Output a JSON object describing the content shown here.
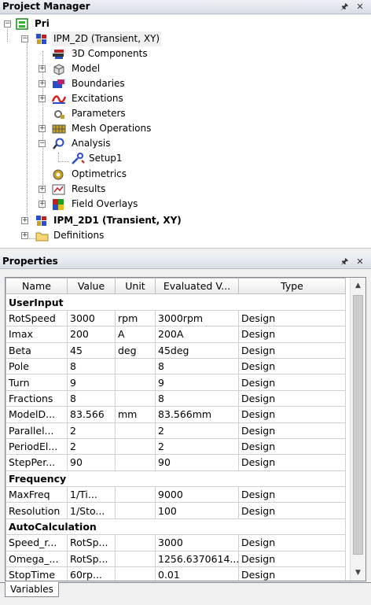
{
  "project_manager": {
    "title": "Project Manager",
    "pin": "p",
    "close": "✕",
    "tree": {
      "root": "Pri",
      "design1": "IPM_2D (Transient, XY)",
      "items": [
        "3D Components",
        "Model",
        "Boundaries",
        "Excitations",
        "Parameters",
        "Mesh Operations",
        "Analysis",
        "Optimetrics",
        "Results",
        "Field Overlays"
      ],
      "setup": "Setup1",
      "design2": "IPM_2D1 (Transient, XY)",
      "definitions": "Definitions"
    }
  },
  "properties": {
    "title": "Properties",
    "columns": [
      "Name",
      "Value",
      "Unit",
      "Evaluated V...",
      "Type"
    ],
    "groups": [
      {
        "name": "UserInput",
        "rows": [
          [
            "RotSpeed",
            "3000",
            "rpm",
            "3000rpm",
            "Design"
          ],
          [
            "Imax",
            "200",
            "A",
            "200A",
            "Design"
          ],
          [
            "Beta",
            "45",
            "deg",
            "45deg",
            "Design"
          ],
          [
            "Pole",
            "8",
            "",
            "8",
            "Design"
          ],
          [
            "Turn",
            "9",
            "",
            "9",
            "Design"
          ],
          [
            "Fractions",
            "8",
            "",
            "8",
            "Design"
          ],
          [
            "ModelD...",
            "83.566",
            "mm",
            "83.566mm",
            "Design"
          ],
          [
            "Parallel...",
            "2",
            "",
            "2",
            "Design"
          ],
          [
            "PeriodEl...",
            "2",
            "",
            "2",
            "Design"
          ],
          [
            "StepPer...",
            "90",
            "",
            "90",
            "Design"
          ]
        ]
      },
      {
        "name": "Frequency",
        "rows": [
          [
            "MaxFreq",
            "1/Ti...",
            "",
            "9000",
            "Design"
          ],
          [
            "Resolution",
            "1/Sto...",
            "",
            "100",
            "Design"
          ]
        ]
      },
      {
        "name": "AutoCalculation",
        "rows": [
          [
            "Speed_r...",
            "RotSp...",
            "",
            "3000",
            "Design"
          ],
          [
            "Omega_...",
            "RotSp...",
            "",
            "1256.6370614...",
            "Design"
          ],
          [
            "StopTime",
            "60rp...",
            "",
            "0.01",
            "Design"
          ]
        ]
      }
    ],
    "tab": "Variables"
  }
}
